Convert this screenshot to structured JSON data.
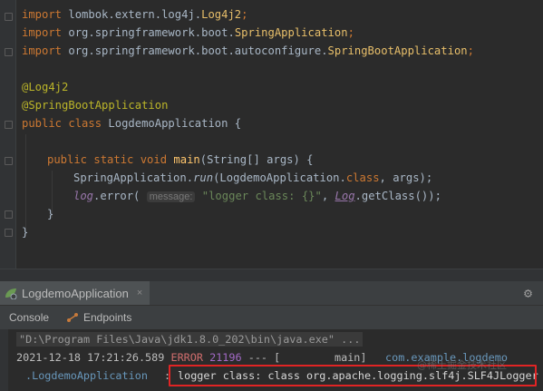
{
  "editor": {
    "line1": {
      "kw": "import",
      "pkg": " lombok.extern.log4j.",
      "cls": "Log4j2",
      "end": ";"
    },
    "line2": {
      "kw": "import",
      "pkg": " org.springframework.boot.",
      "cls": "SpringApplication",
      "end": ";"
    },
    "line3": {
      "kw": "import",
      "pkg": " org.springframework.boot.autoconfigure.",
      "cls": "SpringBootApplication",
      "end": ";"
    },
    "line4": {
      "ann": "@Log4j2"
    },
    "line5": {
      "ann": "@SpringBootApplication"
    },
    "line6": {
      "kw": "public class",
      "name": " LogdemoApplication {"
    },
    "line7": {
      "kw": "public static void",
      "fn": " main",
      "rest": "(String[] args) {"
    },
    "line8": {
      "pre": "SpringApplication.",
      "fn": "run",
      "rest": "(LogdemoApplication.",
      "kw": "class",
      "end": ", args);"
    },
    "line9": {
      "log": "log",
      "pre": ".error( ",
      "hint": "message:",
      "str": " \"logger class: {}\"",
      "mid": ", ",
      "log2": "Log",
      "end": ".getClass());"
    },
    "line10": {
      "text": "}"
    },
    "line11": {
      "text": "}"
    }
  },
  "run_panel": {
    "tab_label": "LogdemoApplication",
    "close_glyph": "×",
    "gear_glyph": "⚙",
    "subtabs": [
      {
        "label": "Console"
      },
      {
        "label": "Endpoints"
      }
    ]
  },
  "console": {
    "cmd": "\"D:\\Program Files\\Java\\jdk1.8.0_202\\bin\\java.exe\" ...",
    "ts": "2021-12-18 17:21:26.589",
    "level": "ERROR",
    "pid": "21196",
    "dash": " --- [",
    "thread": "main]",
    "logger1": "com.example.logdemo",
    "logger2": ".LogdemoApplication",
    "colon": ":",
    "message": "logger class: class org.apache.logging.slf4j.SLF4JLogger"
  },
  "watermark": "@稀土掘金技术社区",
  "colors": {
    "keyword": "#cc7832",
    "annotation": "#bbb529",
    "string": "#6a8759",
    "method": "#ffc66d",
    "highlight": "#e02424"
  }
}
